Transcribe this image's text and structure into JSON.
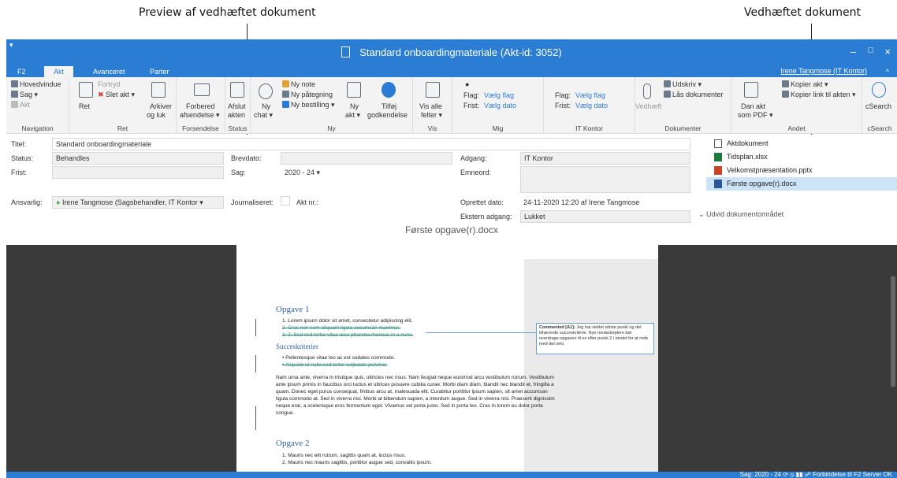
{
  "callouts": {
    "left": "Preview af vedhæftet dokument",
    "right": "Vedhæftet dokument"
  },
  "window": {
    "title": "Standard onboardingmateriale (Akt-id: 3052)",
    "minimize": "–",
    "maximize": "□",
    "close": "×",
    "qat": "▾",
    "collapse": "^"
  },
  "tabs": {
    "f2": "F2",
    "akt": "Akt",
    "avanceret": "Avanceret",
    "parter": "Parter",
    "user": "Irene Tangmose (IT Kontor)"
  },
  "ribbon": {
    "nav": {
      "hovedvindue": "Hovedvindue",
      "sag": "Sag ▾",
      "akt": "Akt",
      "label": "Navigation"
    },
    "ret": {
      "ret": "Ret",
      "fortryd": "Fortryd",
      "slet": "Slet akt ▾",
      "arkiver1": "Arkiver",
      "arkiver2": "og luk",
      "label": "Ret"
    },
    "forsendelse": {
      "forbered1": "Forbered",
      "forbered2": "afsendelse ▾",
      "label": "Forsendelse"
    },
    "status": {
      "afslut1": "Afslut",
      "afslut2": "akten",
      "label": "Status"
    },
    "ny": {
      "chat1": "Ny",
      "chat2": "chat ▾",
      "note": "Ny note",
      "paategning": "Ny påtegning",
      "bestilling": "Ny bestilling ▾",
      "akt1": "Ny",
      "akt2": "akt ▾",
      "tilfoej1": "Tilføj",
      "tilfoej2": "godkendelse",
      "label": "Ny"
    },
    "vis": {
      "vis1": "Vis alle",
      "vis2": "felter ▾",
      "label": "Vis"
    },
    "mig": {
      "flag": "Flag:",
      "vaelgflag": "Vælg flag",
      "frist": "Frist:",
      "vaelgdato": "Vælg dato",
      "label": "Mig"
    },
    "itk": {
      "flag": "Flag:",
      "vaelgflag": "Vælg flag",
      "frist": "Frist:",
      "vaelgdato": "Vælg dato",
      "label": "IT Kontor"
    },
    "dok": {
      "vedhaeft": "Vedhæft",
      "udskriv": "Udskriv ▾",
      "laas": "Lås dokumenter",
      "label": "Dokumenter"
    },
    "andet": {
      "danakt1": "Dan akt",
      "danakt2": "som PDF ▾",
      "kopier": "Kopier akt ▾",
      "kopierlink": "Kopier link til akten ▾",
      "label": "Andet"
    },
    "csearch": {
      "btn": "cSearch",
      "label": "cSearch"
    }
  },
  "fields": {
    "titel_l": "Titel:",
    "titel_v": "Standard onboardingmateriale",
    "status_l": "Status:",
    "status_v": "Behandles",
    "frist_l": "Frist:",
    "ansvarlig_l": "Ansvarlig:",
    "ansvarlig_v": "Irene Tangmose (Sagsbehandler, IT Kontor ▾",
    "brevdato_l": "Brevdato:",
    "sag_l": "Sag:",
    "sag_v": "2020 - 24 ▾",
    "journal_l": "Journaliseret:",
    "aktnr_l": "Akt nr.:",
    "adgang_l": "Adgang:",
    "adgang_v": "IT Kontor",
    "emneord_l": "Emneord:",
    "oprettet_l": "Oprettet dato:",
    "oprettet_v": "24-11-2020 12:20   af   Irene Tangmose",
    "ekstern_l": "Ekstern adgang:",
    "ekstern_v": "Lukket"
  },
  "docs": [
    {
      "name": "Aktdokument",
      "type": "blank"
    },
    {
      "name": "Tidsplan.xlsx",
      "type": "x"
    },
    {
      "name": "Velkomstpræsentation.pptx",
      "type": "p"
    },
    {
      "name": "Første opgave(r).docx",
      "type": "w"
    }
  ],
  "expand": "Udvid dokumentområdet",
  "preview": {
    "title": "Første opgave(r).docx",
    "h1": "Opgave 1",
    "l1": "1.  Lorem ipsum dolor sit amet, consectetur adipiscing elit.",
    "l2": "2.  Cras non sem aliquam ligula accumsan maximus.",
    "l3": "3. 2. Sed sed tortor vitae arcu pharetra rhoncus in a nunc.",
    "h2": "Succeskriterier",
    "b1": "•  Pellentesque vitae leo ac est sodales commodo.",
    "b2": "•  Aliquam ut nulla sed tortor vulputate pulvinar.",
    "para": "Nam urna ante, viverra in tristique quis, ultricies nec risus. Nam feugiat neque euismod arcu vestibulum rutrum. Vestibulum ante ipsum primis in faucibus orci luctus et ultrices posuere cubilia curae; Morbi diam diam, blandit nec blandit et, fringilla a quam. Donec eget purus consequat, finibus arcu at, malesuada elit. Curabitur porttitor ipsum sapien, sit amet accumsan ligula commodo at. Sed in viverra nisi. Morbi at bibendum sapien, a interdum augue. Sed in viverra nisi. Praesent dignissim neque erat, a scelerisque eros fermentum eget. Vivamus vel porta justo. Sed in porta leo. Cras in lorem eu dolor porta congue.",
    "h3": "Opgave 2",
    "m1": "1.  Mauris nec elit rutrum, sagittis quam at, luctus risus.",
    "m2": "2.  Mauris nec mauris sagittis, porttitor augue sed, convallis ipsum.",
    "comment_head": "Commented [A1]:",
    "comment_body": " Jeg har slettet sidste punkt og det tilhørende succeskriterie. Nye medarbejdere bør overdrage opgaven til os efter punkt 2 i stedet for at rode med det selv."
  },
  "statusbar": "Sag: 2020 - 24 ⟳ ⦸ ▮▮ ☍   Forbindelse til F2 Server OK"
}
